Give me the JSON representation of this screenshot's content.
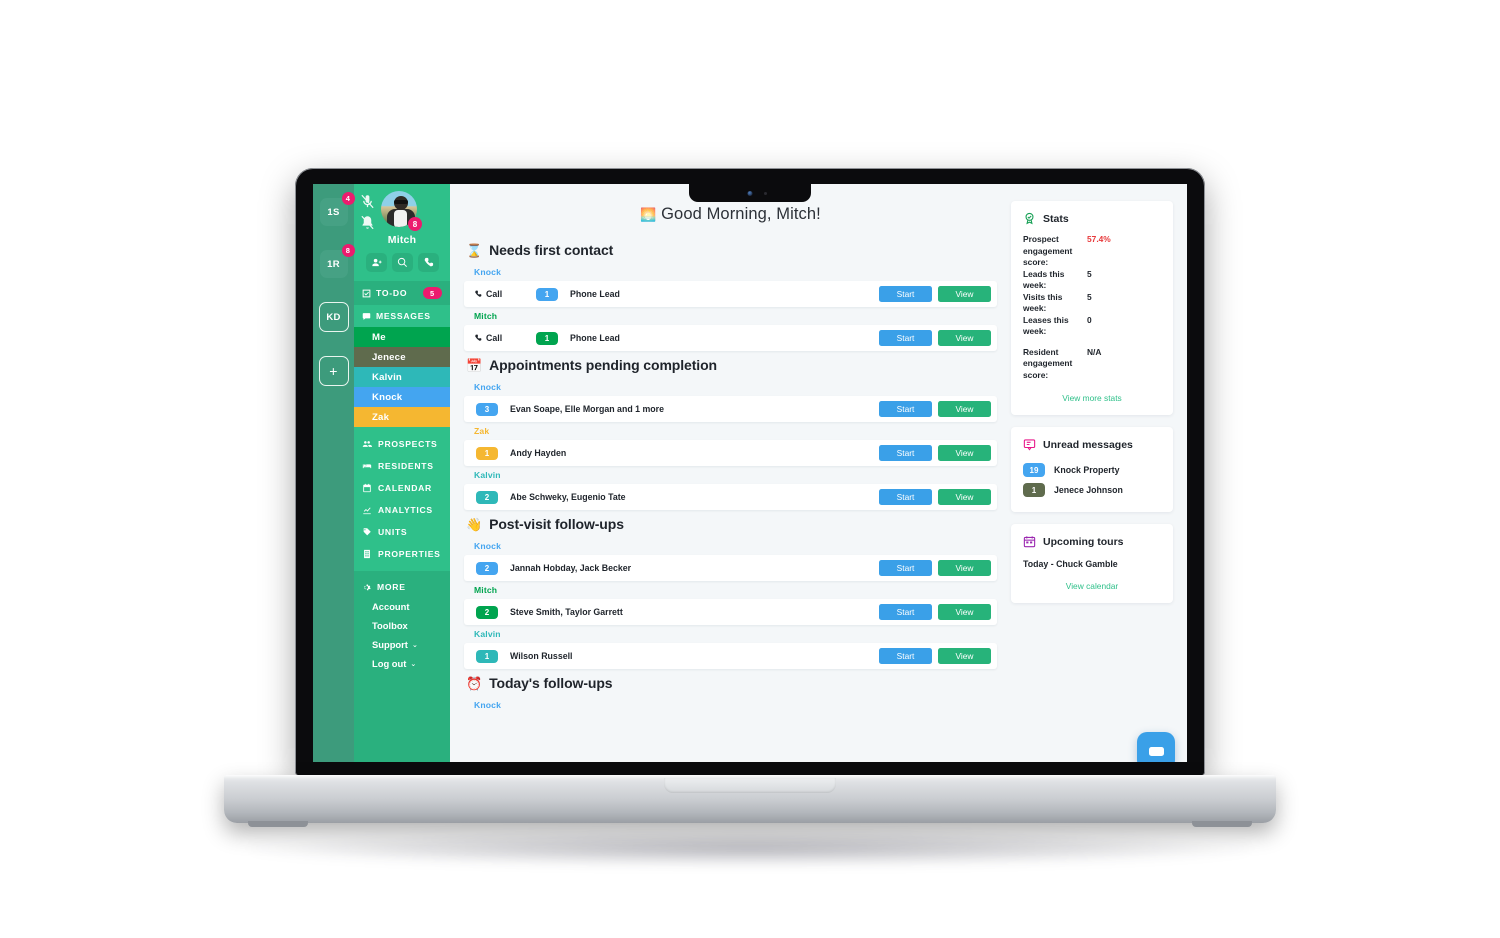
{
  "rail": {
    "tiles": [
      {
        "label": "1S",
        "badge": "4",
        "name": "rail-tile-1s"
      },
      {
        "label": "1R",
        "badge": "8",
        "name": "rail-tile-1r"
      },
      {
        "label": "KD",
        "badge": "",
        "name": "rail-tile-kd"
      },
      {
        "label": "+",
        "badge": "",
        "name": "rail-add-button"
      }
    ]
  },
  "sidebar": {
    "user_name": "Mitch",
    "user_badge": "8",
    "icons": {
      "mic_muted": "microphone-muted-icon",
      "bell_muted": "bell-muted-icon",
      "add_user": "add-user-icon",
      "search": "search-icon",
      "phone": "phone-icon"
    },
    "todo": {
      "label": "TO-DO",
      "badge": "5"
    },
    "messages_label": "MESSAGES",
    "message_items": [
      {
        "label": "Me",
        "color": "#00a44f"
      },
      {
        "label": "Jenece",
        "color": "#5f6b4d"
      },
      {
        "label": "Kalvin",
        "color": "#2eb8b8"
      },
      {
        "label": "Knock",
        "color": "#44a5f0"
      },
      {
        "label": "Zak",
        "color": "#f5b731"
      }
    ],
    "nav_items": [
      {
        "label": "PROSPECTS",
        "icon": "prospects-icon"
      },
      {
        "label": "RESIDENTS",
        "icon": "residents-icon"
      },
      {
        "label": "CALENDAR",
        "icon": "calendar-icon"
      },
      {
        "label": "ANALYTICS",
        "icon": "analytics-icon"
      },
      {
        "label": "UNITS",
        "icon": "units-icon"
      },
      {
        "label": "PROPERTIES",
        "icon": "properties-icon"
      }
    ],
    "more_label": "MORE",
    "more_links": [
      {
        "label": "Account",
        "caret": ""
      },
      {
        "label": "Toolbox",
        "caret": ""
      },
      {
        "label": "Support",
        "caret": "⌄"
      },
      {
        "label": "Log out",
        "caret": "⌄"
      }
    ]
  },
  "main": {
    "greeting_emoji": "🌅",
    "greeting": "Good Morning, Mitch!",
    "buttons": {
      "start": "Start",
      "view": "View"
    },
    "colors": {
      "start": "#3aa0e8",
      "view": "#27b37a",
      "knock": "#44a5f0",
      "mitch": "#00a44f",
      "zak": "#f5b731",
      "kalvin": "#2eb8b8",
      "jenece": "#5f6b4d"
    },
    "sections": [
      {
        "emoji": "⌛",
        "title": "Needs first contact",
        "groups": [
          {
            "agent": "Knock",
            "color": "#44a5f0",
            "rows": [
              {
                "call": "Call",
                "count": "1",
                "names": "Phone Lead"
              }
            ]
          },
          {
            "agent": "Mitch",
            "color": "#00a44f",
            "rows": [
              {
                "call": "Call",
                "count": "1",
                "names": "Phone Lead"
              }
            ]
          }
        ]
      },
      {
        "emoji": "📅",
        "title": "Appointments pending completion",
        "groups": [
          {
            "agent": "Knock",
            "color": "#44a5f0",
            "rows": [
              {
                "call": "",
                "count": "3",
                "names": "Evan Soape, Elle Morgan and 1 more"
              }
            ]
          },
          {
            "agent": "Zak",
            "color": "#f5b731",
            "rows": [
              {
                "call": "",
                "count": "1",
                "names": "Andy Hayden"
              }
            ]
          },
          {
            "agent": "Kalvin",
            "color": "#2eb8b8",
            "rows": [
              {
                "call": "",
                "count": "2",
                "names": "Abe Schweky, Eugenio Tate"
              }
            ]
          }
        ]
      },
      {
        "emoji": "👋",
        "title": "Post-visit follow-ups",
        "groups": [
          {
            "agent": "Knock",
            "color": "#44a5f0",
            "rows": [
              {
                "call": "",
                "count": "2",
                "names": "Jannah Hobday, Jack Becker"
              }
            ]
          },
          {
            "agent": "Mitch",
            "color": "#00a44f",
            "rows": [
              {
                "call": "",
                "count": "2",
                "names": "Steve Smith, Taylor Garrett"
              }
            ]
          },
          {
            "agent": "Kalvin",
            "color": "#2eb8b8",
            "rows": [
              {
                "call": "",
                "count": "1",
                "names": "Wilson Russell"
              }
            ]
          }
        ]
      },
      {
        "emoji": "⏰",
        "title": "Today's follow-ups",
        "groups": [
          {
            "agent": "Knock",
            "color": "#44a5f0",
            "rows": []
          }
        ]
      }
    ]
  },
  "right": {
    "stats": {
      "icon": "award-icon",
      "title": "Stats",
      "rows": [
        {
          "key": "Prospect engagement score:",
          "value": "57.4%",
          "red": true
        },
        {
          "key": "Leads this week:",
          "value": "5",
          "red": false
        },
        {
          "key": "Visits this week:",
          "value": "5",
          "red": false
        },
        {
          "key": "Leases this week:",
          "value": "0",
          "red": false
        }
      ],
      "resident": {
        "key": "Resident engagement score:",
        "value": "N/A"
      },
      "link": "View more stats"
    },
    "unread": {
      "icon": "chat-box-icon",
      "title": "Unread messages",
      "items": [
        {
          "count": "19",
          "name": "Knock Property",
          "color": "#44a5f0"
        },
        {
          "count": "1",
          "name": "Jenece Johnson",
          "color": "#5f6b4d"
        }
      ]
    },
    "tours": {
      "icon": "calendar-icon",
      "title": "Upcoming tours",
      "entry": "Today - Chuck Gamble",
      "link": "View calendar"
    }
  },
  "chat_fab": {
    "icon": "chat-bubble-icon"
  }
}
